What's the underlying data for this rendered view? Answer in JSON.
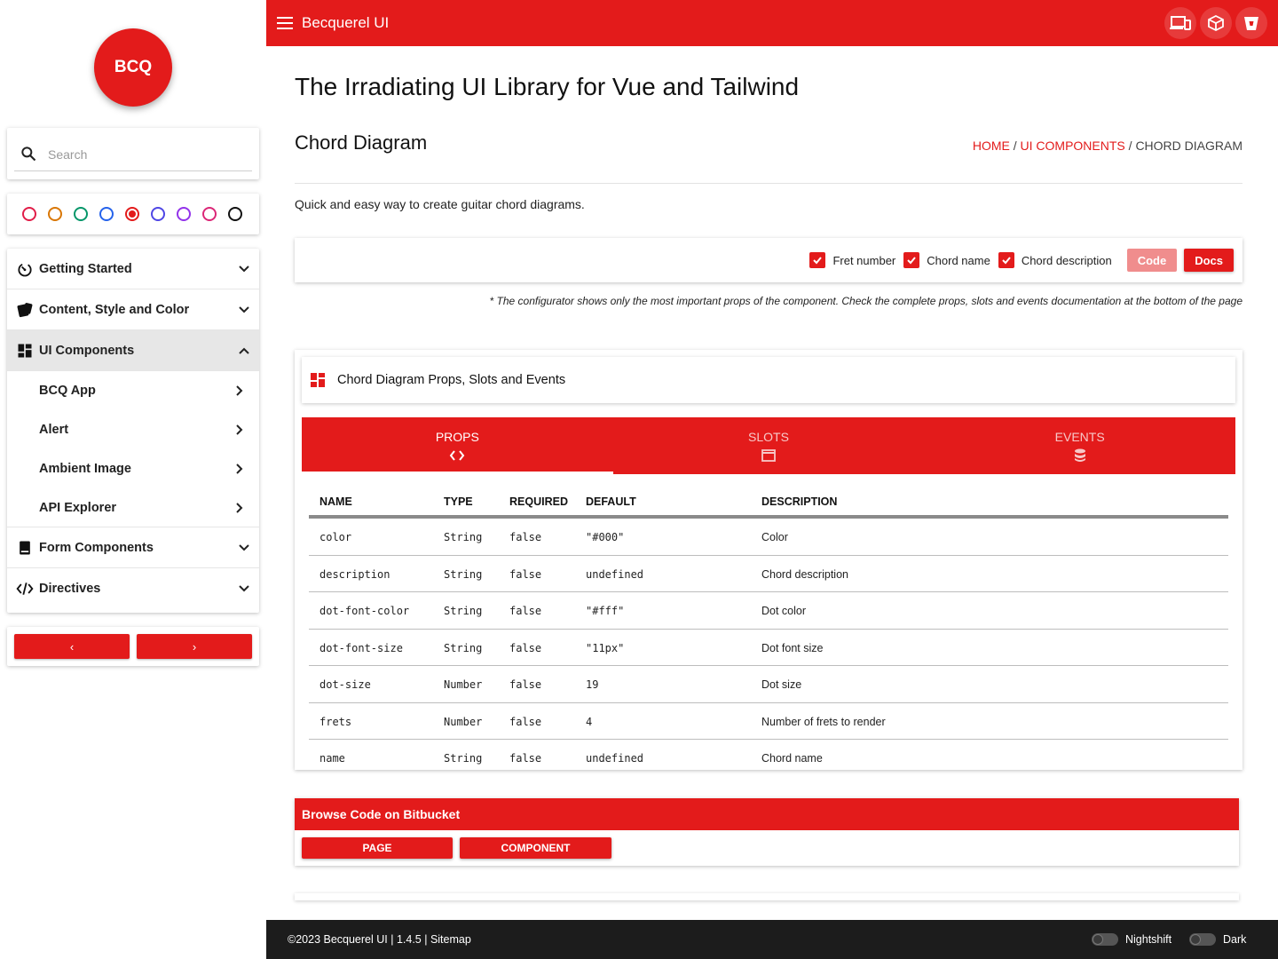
{
  "sidebar": {
    "logo": "BCQ",
    "search": {
      "placeholder": "Search"
    },
    "swatches": [
      {
        "name": "rose",
        "color": "#e11d48",
        "selected": false
      },
      {
        "name": "amber",
        "color": "#d97706",
        "selected": false
      },
      {
        "name": "emerald",
        "color": "#059669",
        "selected": false
      },
      {
        "name": "blue",
        "color": "#2563eb",
        "selected": false
      },
      {
        "name": "red",
        "color": "#e31b1b",
        "selected": true
      },
      {
        "name": "indigo",
        "color": "#4f46e5",
        "selected": false
      },
      {
        "name": "purple",
        "color": "#9333ea",
        "selected": false
      },
      {
        "name": "pink",
        "color": "#db2777",
        "selected": false
      },
      {
        "name": "black",
        "color": "#111111",
        "selected": false
      }
    ],
    "nav": {
      "getting_started": "Getting Started",
      "content_style": "Content, Style and Color",
      "ui_components": "UI Components",
      "sub_items": [
        "BCQ App",
        "Alert",
        "Ambient Image",
        "API Explorer"
      ],
      "form_components": "Form Components",
      "directives": "Directives"
    },
    "pager": {
      "prev": "‹",
      "next": "›"
    }
  },
  "topbar": {
    "title": "Becquerel UI",
    "icons": [
      "devices-icon",
      "package-icon",
      "bitbucket-icon"
    ]
  },
  "main": {
    "heading": "The Irradiating UI Library for Vue and Tailwind",
    "component_title": "Chord Diagram",
    "breadcrumb": {
      "home": "HOME",
      "sep": " / ",
      "section": "UI COMPONENTS",
      "current": "CHORD DIAGRAM"
    },
    "description": "Quick and easy way to create guitar chord diagrams.",
    "configurator": {
      "checkboxes": [
        "Fret number",
        "Chord name",
        "Chord description"
      ],
      "code_button": "Code",
      "docs_button": "Docs"
    },
    "note": "* The configurator shows only the most important props of the component. Check the complete props, slots and events documentation at the bottom of the page",
    "props_panel": {
      "title": "Chord Diagram Props, Slots and Events",
      "tabs": [
        "PROPS",
        "SLOTS",
        "EVENTS"
      ],
      "active_tab": "PROPS",
      "columns": [
        "NAME",
        "TYPE",
        "REQUIRED",
        "DEFAULT",
        "DESCRIPTION"
      ],
      "rows": [
        [
          "color",
          "String",
          "false",
          "\"#000\"",
          "Color"
        ],
        [
          "description",
          "String",
          "false",
          "undefined",
          "Chord description"
        ],
        [
          "dot-font-color",
          "String",
          "false",
          "\"#fff\"",
          "Dot color"
        ],
        [
          "dot-font-size",
          "String",
          "false",
          "\"11px\"",
          "Dot font size"
        ],
        [
          "dot-size",
          "Number",
          "false",
          "19",
          "Dot size"
        ],
        [
          "frets",
          "Number",
          "false",
          "4",
          "Number of frets to render"
        ],
        [
          "name",
          "String",
          "false",
          "undefined",
          "Chord name"
        ]
      ]
    },
    "browse": {
      "title": "Browse Code on Bitbucket",
      "page_button": "PAGE",
      "component_button": "COMPONENT"
    }
  },
  "footer": {
    "text": "©2023 Becquerel UI | 1.4.5 | Sitemap",
    "nightshift": "Nightshift",
    "dark": "Dark"
  },
  "colors": {
    "accent": "#e31b1b",
    "footer_bg": "#1c1c1c"
  }
}
